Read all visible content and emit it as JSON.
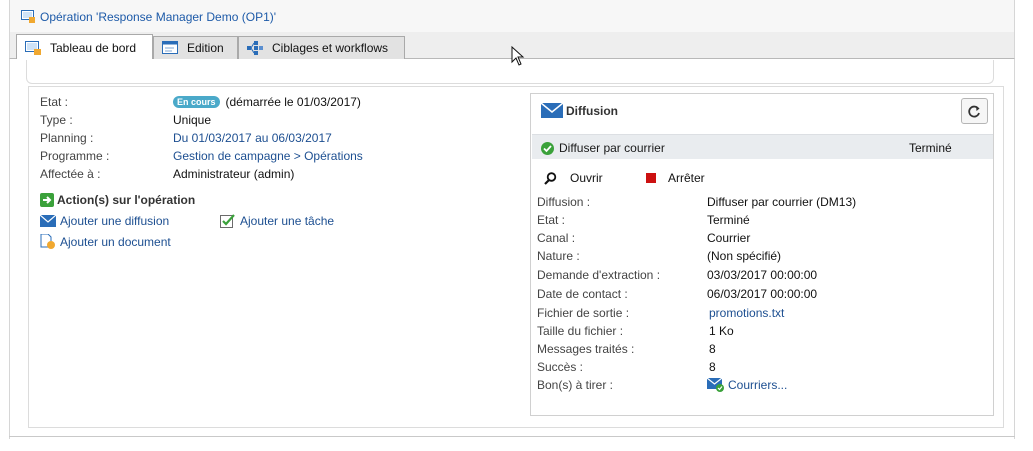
{
  "window": {
    "title": "Opération 'Response Manager Demo (OP1)'"
  },
  "tabs": [
    {
      "label": "Tableau de bord",
      "icon": "dashboard-icon",
      "active": true
    },
    {
      "label": "Edition",
      "icon": "window-edit-icon",
      "active": false
    },
    {
      "label": "Ciblages et workflows",
      "icon": "workflow-icon",
      "active": false
    }
  ],
  "operation": {
    "etat_label": "Etat :",
    "etat_badge": "En cours",
    "etat_value": "(démarrée le 01/03/2017)",
    "type_label": "Type :",
    "type_value": "Unique",
    "planning_label": "Planning :",
    "planning_value": "Du 01/03/2017 au 06/03/2017",
    "programme_label": "Programme :",
    "programme_value": "Gestion de campagne > Opérations",
    "affectee_label": "Affectée à :",
    "affectee_value": "Administrateur (admin)"
  },
  "actions": {
    "title": "Action(s) sur l'opération",
    "add_delivery": "Ajouter une diffusion",
    "add_task": "Ajouter une tâche",
    "add_document": "Ajouter un document"
  },
  "diffusion": {
    "title": "Diffusion",
    "item_label": "Diffuser par courrier",
    "item_status": "Terminé",
    "open_label": "Ouvrir",
    "stop_label": "Arrêter",
    "details": [
      {
        "label": "Diffusion :",
        "value": "Diffuser par courrier (DM13)",
        "link": false
      },
      {
        "label": "Etat :",
        "value": "Terminé",
        "link": false
      },
      {
        "label": "Canal :",
        "value": "Courrier",
        "link": false
      },
      {
        "label": "Nature :",
        "value": "(Non spécifié)",
        "link": false
      },
      {
        "label": "Demande d'extraction :",
        "value": "03/03/2017 00:00:00",
        "link": false
      },
      {
        "label": "Date de contact :",
        "value": "06/03/2017 00:00:00",
        "link": false
      },
      {
        "label": "Fichier de sortie :",
        "value": "promotions.txt",
        "link": true
      },
      {
        "label": "Taille du fichier :",
        "value": "1 Ko",
        "link": false
      },
      {
        "label": "Messages traités :",
        "value": "8",
        "link": false
      },
      {
        "label": "Succès :",
        "value": "8",
        "link": false
      },
      {
        "label": "Bon(s) à tirer :",
        "value": "Courriers...",
        "link": true
      }
    ]
  },
  "colors": {
    "link": "#1d4f91",
    "badge": "#4aa9c9",
    "success": "#3aa13a",
    "stop": "#cc1111",
    "band": "#e9ecef"
  }
}
